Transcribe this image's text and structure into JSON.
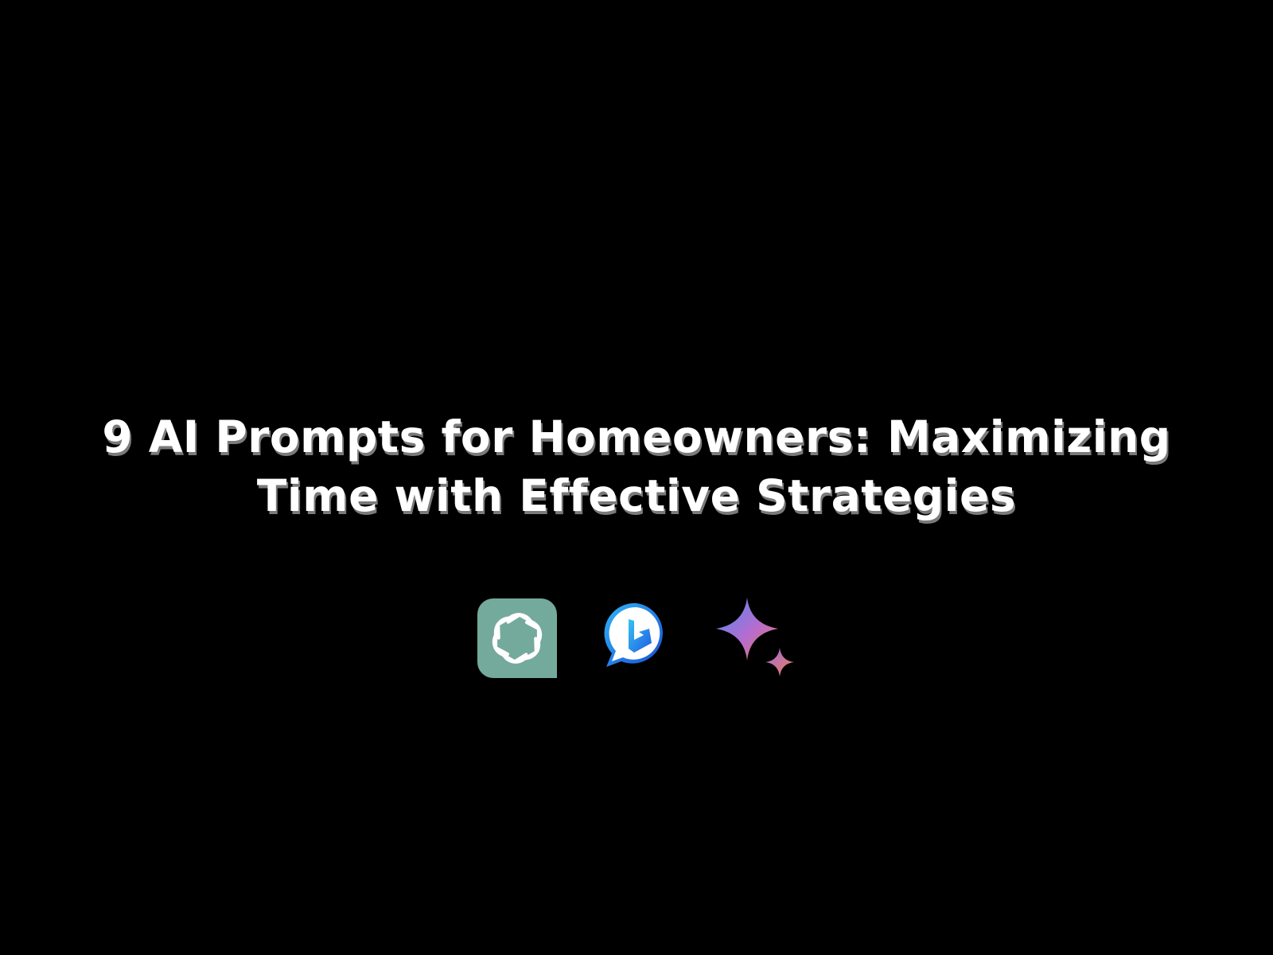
{
  "headline": {
    "line1": "9 AI Prompts for Homeowners: Maximizing",
    "line2": "Time with Effective Strategies"
  },
  "logos": [
    {
      "icon": "chatgpt-logo-icon",
      "background": "#74AA9C"
    },
    {
      "icon": "bing-chat-logo-icon",
      "accent": "#1E6FE0"
    },
    {
      "icon": "gemini-sparkle-logo-icon",
      "gradient": [
        "#4A8CF0",
        "#C768C9",
        "#F0785A"
      ]
    }
  ],
  "colors": {
    "background": "#000000",
    "text": "#FFFFFF",
    "text_shadow": "#7A7A7A"
  }
}
